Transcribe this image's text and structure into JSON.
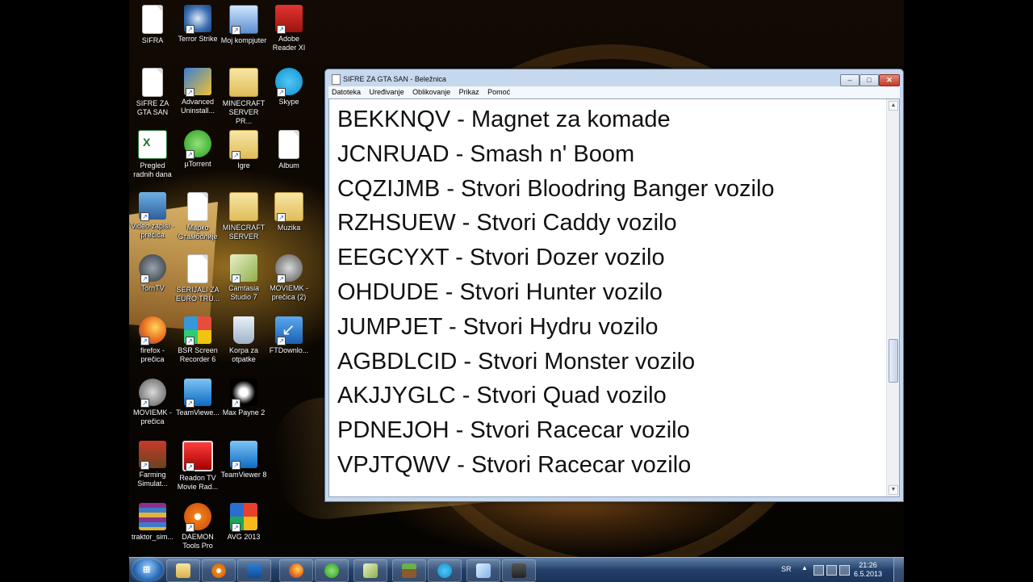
{
  "desktop": {
    "icons": [
      {
        "id": "sifra",
        "label": "SIFRA"
      },
      {
        "id": "terror",
        "label": "Terror Strike"
      },
      {
        "id": "computer",
        "label": "Moj kompjuter"
      },
      {
        "id": "adobe",
        "label": "Adobe Reader XI"
      },
      {
        "id": "sifre",
        "label": "SIFRE ZA GTA SAN"
      },
      {
        "id": "advanced",
        "label": "Advanced Uninstall..."
      },
      {
        "id": "minecraft1",
        "label": "MINECRAFT SERVER PR..."
      },
      {
        "id": "skype",
        "label": "Skype"
      },
      {
        "id": "pregled",
        "label": "Pregled radnih dana"
      },
      {
        "id": "utorrent",
        "label": "µTorrent"
      },
      {
        "id": "igre",
        "label": "Igre"
      },
      {
        "id": "album",
        "label": "Album"
      },
      {
        "id": "video",
        "label": "Video zapisi - prečica"
      },
      {
        "id": "marko",
        "label": "Марко Стамболије"
      },
      {
        "id": "minecraft2",
        "label": "MINECRAFT SERVER"
      },
      {
        "id": "muzika",
        "label": "Muzika"
      },
      {
        "id": "torntv",
        "label": "TornTV"
      },
      {
        "id": "serijali",
        "label": "SERIJALI ZA EURO TRU..."
      },
      {
        "id": "camtasia",
        "label": "Camtasia Studio 7"
      },
      {
        "id": "moviemk2",
        "label": "MOVIEMK - prečica (2)"
      },
      {
        "id": "firefox",
        "label": "firefox - prečica"
      },
      {
        "id": "bsr",
        "label": "BSR Screen Recorder 6"
      },
      {
        "id": "korpa",
        "label": "Korpa za otpatke"
      },
      {
        "id": "ftdown",
        "label": "FTDownlo..."
      },
      {
        "id": "moviemk",
        "label": "MOVIEMK - prečica"
      },
      {
        "id": "teamviewer",
        "label": "TeamViewe..."
      },
      {
        "id": "maxpayne",
        "label": "Max Payne 2"
      },
      {
        "id": "farming",
        "label": "Farming Simulat..."
      },
      {
        "id": "readon",
        "label": "Readon TV Movie Rad..."
      },
      {
        "id": "teamviewer8",
        "label": "TeamViewer 8"
      },
      {
        "id": "traktor",
        "label": "traktor_sim..."
      },
      {
        "id": "daemon",
        "label": "DAEMON Tools Pro"
      },
      {
        "id": "avg",
        "label": "AVG 2013"
      }
    ]
  },
  "notepad": {
    "title": "SIFRE ZA GTA SAN - Beležnica",
    "controls": {
      "minimize": "–",
      "maximize": "□",
      "close": "✕"
    },
    "menu": [
      "Datoteka",
      "Uređivanje",
      "Oblikovanje",
      "Prikaz",
      "Pomoć"
    ],
    "lines": [
      "BEKKNQV - Magnet za komade",
      "JCNRUAD - Smash n' Boom",
      "CQZIJMB - Stvori Bloodring Banger vozilo",
      "RZHSUEW - Stvori Caddy vozilo",
      "EEGCYXT - Stvori Dozer vozilo",
      "OHDUDE - Stvori Hunter vozilo",
      "JUMPJET - Stvori Hydru vozilo",
      "AGBDLCID - Stvori Monster vozilo",
      "AKJJYGLC - Stvori Quad vozilo",
      "PDNEJOH - Stvori Racecar vozilo",
      "VPJTQWV - Stvori Racecar vozilo"
    ]
  },
  "taskbar": {
    "language": "SR",
    "time": "21:26",
    "date": "6.5.2013",
    "pinned": [
      "explorer",
      "media-player",
      "outlook",
      "firefox",
      "utorrent",
      "camtasia",
      "minecraft",
      "skype",
      "notepad",
      "camera"
    ]
  }
}
